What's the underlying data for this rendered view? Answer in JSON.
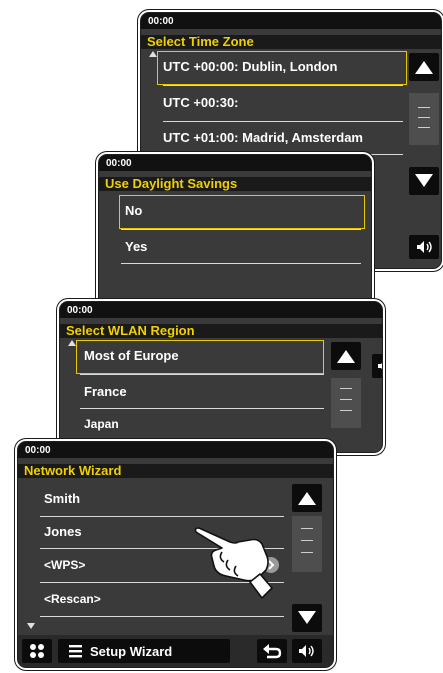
{
  "screens": {
    "timezone": {
      "clock": "00:00",
      "title": "Select Time Zone",
      "items": [
        "UTC +00:00: Dublin, London",
        "UTC +00:30:",
        "UTC +01:00: Madrid, Amsterdam"
      ]
    },
    "daylight": {
      "clock": "00:00",
      "title": "Use Daylight Savings",
      "items": [
        "No",
        "Yes"
      ]
    },
    "wlan": {
      "clock": "00:00",
      "title": "Select WLAN Region",
      "items": [
        "Most of Europe",
        "France",
        "Japan"
      ]
    },
    "wizard": {
      "clock": "00:00",
      "title": "Network Wizard",
      "items": [
        "Smith",
        "Jones",
        "<WPS>",
        "<Rescan>"
      ],
      "footer_label": "Setup Wizard"
    }
  },
  "icons": {
    "scroll_up": "triangle-up-icon",
    "scroll_down": "triangle-down-icon",
    "volume": "speaker-icon",
    "menu": "grid-menu-icon",
    "list": "list-icon",
    "back": "return-arrow-icon",
    "more": "chevron-right-icon",
    "hand": "pointing-hand-icon"
  },
  "colors": {
    "title": "#f0d000",
    "selection": "#e8c800",
    "screen_bg": "#3a3a3a",
    "status_bg": "#111111"
  }
}
